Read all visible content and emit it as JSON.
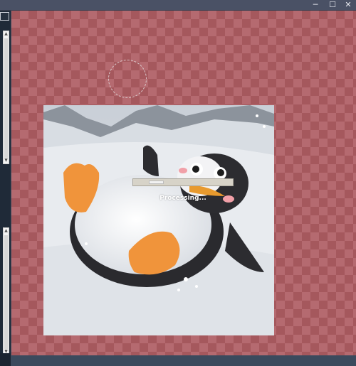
{
  "window": {
    "controls": [
      {
        "name": "minimize",
        "glyph": "─"
      },
      {
        "name": "maximize",
        "glyph": "☐"
      },
      {
        "name": "close",
        "glyph": "✕"
      }
    ]
  },
  "canvas": {
    "colors": {
      "checker_a": "#a5585d",
      "checker_b": "#b56a70"
    }
  },
  "image": {
    "description_icon": "penguin-image"
  },
  "processing": {
    "label": "Processing...",
    "progress": 0.15
  }
}
